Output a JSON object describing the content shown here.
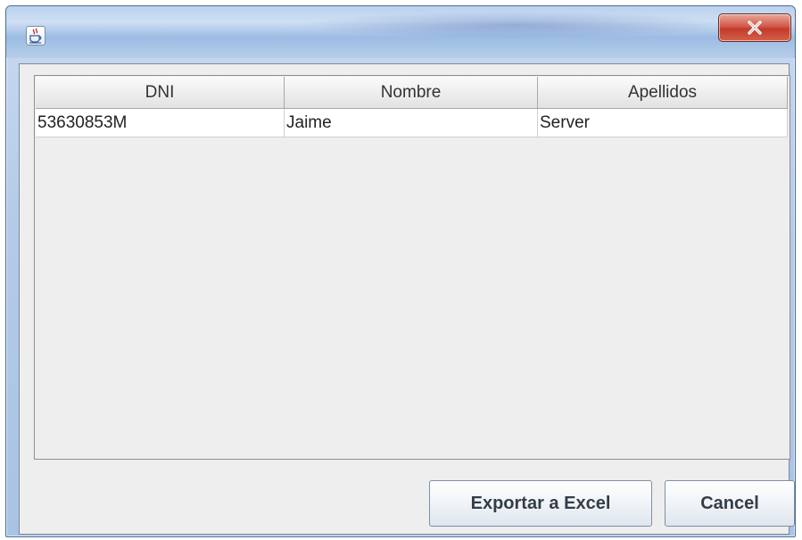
{
  "window": {
    "title": "",
    "close_label": "x"
  },
  "table": {
    "columns": [
      "DNI",
      "Nombre",
      "Apellidos"
    ],
    "rows": [
      [
        "53630853M",
        "Jaime",
        "Server"
      ]
    ]
  },
  "buttons": {
    "export_label": "Exportar a Excel",
    "cancel_label": "Cancel"
  },
  "colors": {
    "title_bar": "#b9d1ee",
    "close_button": "#c23b2a",
    "client_background": "#eeeeee"
  },
  "icons": {
    "app": "java-coffee-cup-icon",
    "close": "close-icon"
  }
}
